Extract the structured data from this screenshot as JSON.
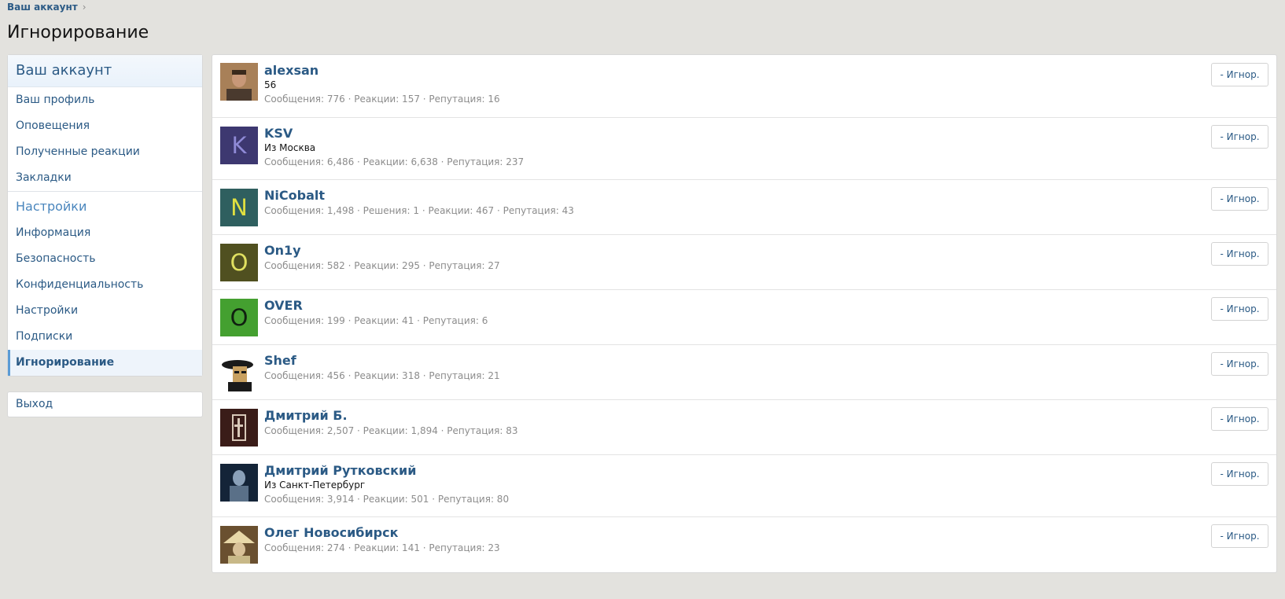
{
  "breadcrumb": {
    "label": "Ваш аккаунт",
    "separator": "›"
  },
  "page_title": "Игнорирование",
  "sidebar": {
    "heading": "Ваш аккаунт",
    "items": [
      "Ваш профиль",
      "Оповещения",
      "Полученные реакции",
      "Закладки"
    ],
    "settings_heading": "Настройки",
    "settings_items": [
      "Информация",
      "Безопасность",
      "Конфиденциальность",
      "Настройки",
      "Подписки",
      "Игнорирование"
    ],
    "logout": "Выход"
  },
  "colors": {
    "link": "#2b5a85",
    "accent": "#4a86bd",
    "background": "#e3e2de",
    "muted": "#8c8c8c"
  },
  "users": [
    {
      "name": "alexsan",
      "title": "56",
      "stats": "Сообщения: 776 · Реакции: 157 · Репутация: 16",
      "avatar_letter": "",
      "avatar_bg": "#a07850",
      "avatar_fg": "#ffffff",
      "button": "- Игнор."
    },
    {
      "name": "KSV",
      "title": "Из Москва",
      "stats": "Сообщения: 6,486 · Реакции: 6,638 · Репутация: 237",
      "avatar_letter": "K",
      "avatar_bg": "#3d3870",
      "avatar_fg": "#8f8ad6",
      "button": "- Игнор."
    },
    {
      "name": "NiCobalt",
      "title": "",
      "stats": "Сообщения: 1,498 · Решения: 1 · Реакции: 467 · Репутация: 43",
      "avatar_letter": "N",
      "avatar_bg": "#2f5f5f",
      "avatar_fg": "#e0e040",
      "button": "- Игнор."
    },
    {
      "name": "On1y",
      "title": "",
      "stats": "Сообщения: 582 · Реакции: 295 · Репутация: 27",
      "avatar_letter": "O",
      "avatar_bg": "#505020",
      "avatar_fg": "#e0e060",
      "button": "- Игнор."
    },
    {
      "name": "OVER",
      "title": "",
      "stats": "Сообщения: 199 · Реакции: 41 · Репутация: 6",
      "avatar_letter": "O",
      "avatar_bg": "#44a030",
      "avatar_fg": "#102010",
      "button": "- Игнор."
    },
    {
      "name": "Shef",
      "title": "",
      "stats": "Сообщения: 456 · Реакции: 318 · Репутация: 21",
      "avatar_letter": "",
      "avatar_bg": "#1a1a1a",
      "avatar_fg": "#ffffff",
      "button": "- Игнор."
    },
    {
      "name": "Дмитрий Б.",
      "title": "",
      "stats": "Сообщения: 2,507 · Реакции: 1,894 · Репутация: 83",
      "avatar_letter": "",
      "avatar_bg": "#3a1c18",
      "avatar_fg": "#ffffff",
      "button": "- Игнор."
    },
    {
      "name": "Дмитрий Рутковский",
      "title": "Из Санкт-Петербург",
      "stats": "Сообщения: 3,914 · Реакции: 501 · Репутация: 80",
      "avatar_letter": "",
      "avatar_bg": "#142438",
      "avatar_fg": "#ffffff",
      "button": "- Игнор."
    },
    {
      "name": "Олег Новосибирск",
      "title": "",
      "stats": "Сообщения: 274 · Реакции: 141 · Репутация: 23",
      "avatar_letter": "",
      "avatar_bg": "#8a7040",
      "avatar_fg": "#ffffff",
      "button": "- Игнор."
    }
  ]
}
